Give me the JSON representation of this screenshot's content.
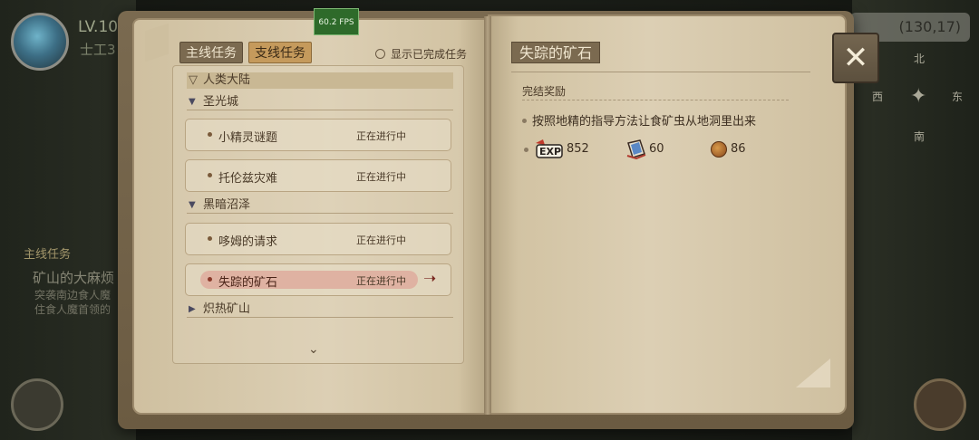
{
  "hud": {
    "level": "LV.10",
    "player_name": "士工3",
    "main_quest_label": "主线任务",
    "main_quest_name": "矿山的大麻烦",
    "main_quest_desc": "突袭南边食人魔\n住食人魔首领的",
    "coords": "(130,17)",
    "compass": {
      "n": "北",
      "s": "南",
      "e": "东",
      "w": "西"
    },
    "fps": "60.2 FPS"
  },
  "left_page": {
    "tabs": [
      {
        "label": "主线任务",
        "active": false
      },
      {
        "label": "支线任务",
        "active": true
      }
    ],
    "show_completed_label": "显示已完成任务",
    "region": "人类大陆",
    "groups": [
      {
        "name": "圣光城",
        "expanded": true,
        "quests": [
          {
            "name": "小精灵谜题",
            "status": "正在进行中"
          },
          {
            "name": "托伦兹灾难",
            "status": "正在进行中"
          }
        ]
      },
      {
        "name": "黑暗沼泽",
        "expanded": true,
        "quests": [
          {
            "name": "哆姆的请求",
            "status": "正在进行中"
          },
          {
            "name": "失踪的矿石",
            "status": "正在进行中",
            "selected": true
          }
        ]
      },
      {
        "name": "炽热矿山",
        "expanded": false,
        "quests": []
      }
    ]
  },
  "right_page": {
    "title": "失踪的矿石",
    "rewards_heading": "完结奖励",
    "description": "按照地精的指导方法让食矿虫从地洞里出来",
    "rewards": {
      "exp_label": "EXP",
      "exp": "852",
      "gem": "60",
      "coin": "86"
    }
  },
  "colors": {
    "page": "#dccfb4",
    "tab_active": "#c59a5c",
    "selected_highlight": "#dfb2a2",
    "cover": "#6b5b42"
  }
}
